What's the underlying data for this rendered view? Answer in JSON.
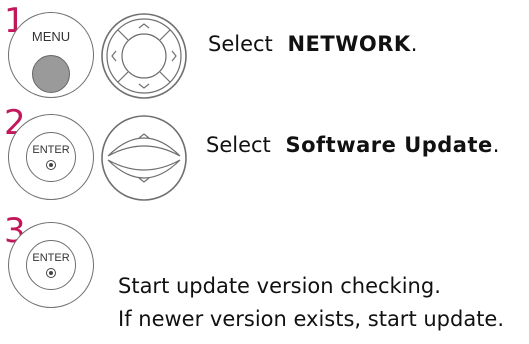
{
  "steps": [
    {
      "number": "1",
      "button_label": "MENU",
      "instruction_prefix": "Select",
      "instruction_target": "NETWORK",
      "instruction_suffix": "."
    },
    {
      "number": "2",
      "button_label": "ENTER",
      "instruction_prefix": "Select",
      "instruction_target": "Software Update",
      "instruction_suffix": "."
    },
    {
      "number": "3",
      "button_label": "ENTER",
      "instruction_line1": "Start update version checking.",
      "instruction_line2": "If newer version exists, start update."
    }
  ],
  "colors": {
    "step_number": "#c2185b",
    "outline": "#6f6f6f",
    "button_fill_gray": "#9a9a9a"
  },
  "icons": {
    "menu_button": "menu-button-icon",
    "nav_ring": "four-way-navigation-ring-icon",
    "enter_button": "enter-button-icon",
    "up_down_rocker": "up-down-rocker-icon"
  }
}
